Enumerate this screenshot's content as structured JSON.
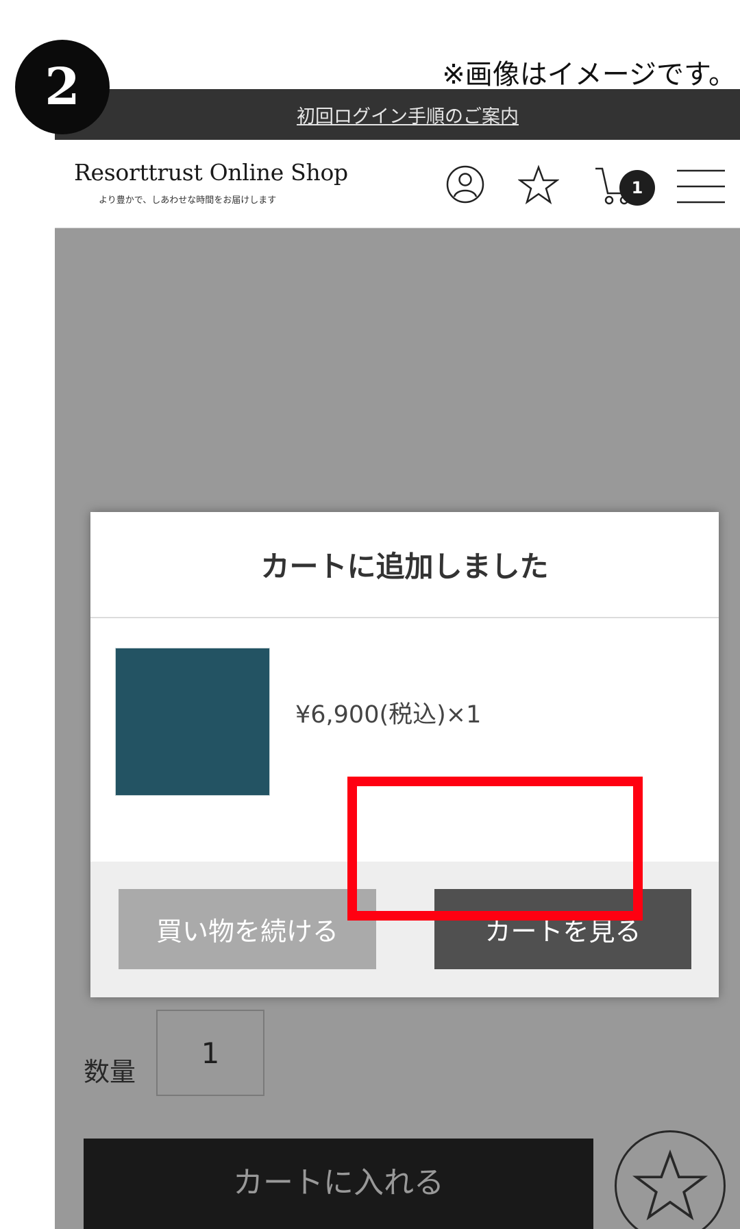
{
  "step_number": "2",
  "disclaimer": "※画像はイメージです。",
  "login_bar": {
    "link_text": "初回ログイン手順のご案内"
  },
  "header": {
    "logo_title": "Resorttrust Online Shop",
    "logo_subtitle": "より豊かで、しあわせな時間をお届けします",
    "cart_count": "1",
    "icons": [
      "user-icon",
      "star-icon",
      "cart-icon",
      "hamburger-menu-icon"
    ]
  },
  "page": {
    "quantity_label": "数量",
    "quantity_value": "1",
    "add_to_cart_label": "カートに入れる"
  },
  "modal": {
    "title": "カートに追加しました",
    "product": {
      "name": "",
      "price": "¥6,900(税込)×1",
      "thumb_color": "#235363"
    },
    "continue_label": "買い物を続ける",
    "view_cart_label": "カートを見る"
  },
  "colors": {
    "highlight": "#ff0011",
    "top_bar": "#333333"
  }
}
